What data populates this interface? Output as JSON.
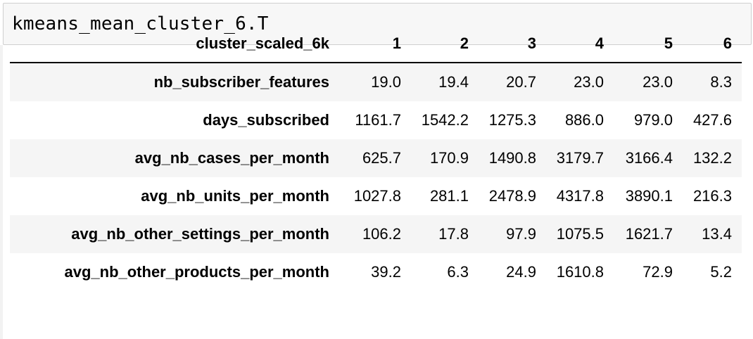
{
  "code_cell": {
    "input": "kmeans_mean_cluster_6.T"
  },
  "table": {
    "index_header": "cluster_scaled_6k",
    "columns": [
      "1",
      "2",
      "3",
      "4",
      "5",
      "6"
    ],
    "rows": [
      {
        "label": "nb_subscriber_features",
        "values": [
          "19.0",
          "19.4",
          "20.7",
          "23.0",
          "23.0",
          "8.3"
        ]
      },
      {
        "label": "days_subscribed",
        "values": [
          "1161.7",
          "1542.2",
          "1275.3",
          "886.0",
          "979.0",
          "427.6"
        ]
      },
      {
        "label": "avg_nb_cases_per_month",
        "values": [
          "625.7",
          "170.9",
          "1490.8",
          "3179.7",
          "3166.4",
          "132.2"
        ]
      },
      {
        "label": "avg_nb_units_per_month",
        "values": [
          "1027.8",
          "281.1",
          "2478.9",
          "4317.8",
          "3890.1",
          "216.3"
        ]
      },
      {
        "label": "avg_nb_other_settings_per_month",
        "values": [
          "106.2",
          "17.8",
          "97.9",
          "1075.5",
          "1621.7",
          "13.4"
        ]
      },
      {
        "label": "avg_nb_other_products_per_month",
        "values": [
          "39.2",
          "6.3",
          "24.9",
          "1610.8",
          "72.9",
          "5.2"
        ]
      }
    ]
  }
}
